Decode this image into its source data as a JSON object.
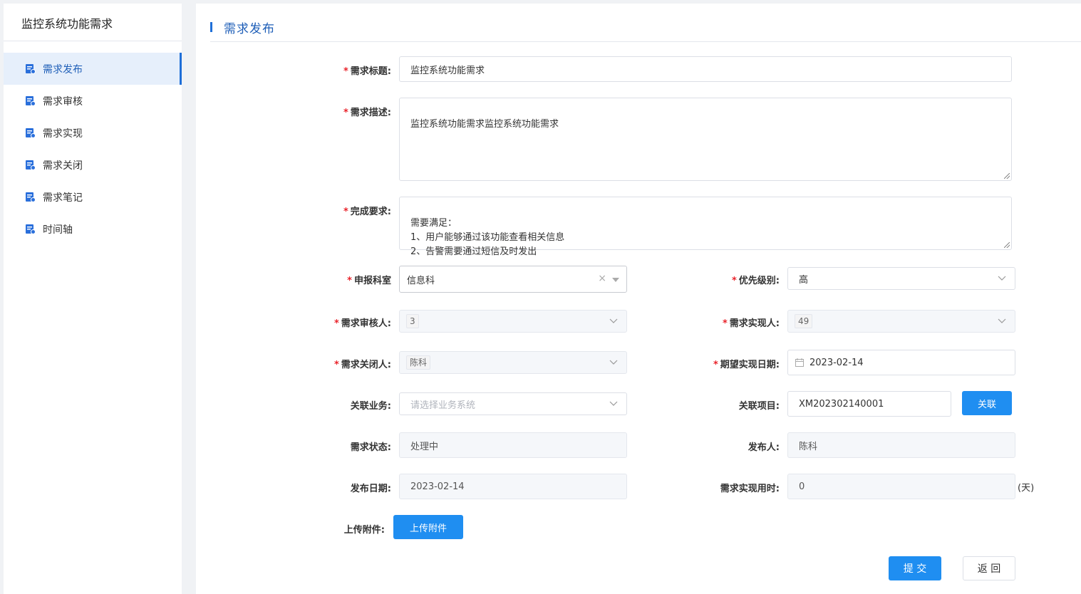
{
  "sidebar": {
    "title": "监控系统功能需求",
    "items": [
      {
        "label": "需求发布"
      },
      {
        "label": "需求审核"
      },
      {
        "label": "需求实现"
      },
      {
        "label": "需求关闭"
      },
      {
        "label": "需求笔记"
      },
      {
        "label": "时间轴"
      }
    ]
  },
  "header": {
    "title": "需求发布"
  },
  "form": {
    "required_mark": "*",
    "title_label": "需求标题:",
    "title_value": "监控系统功能需求",
    "desc_label": "需求描述:",
    "desc_value": "监控系统功能需求监控系统功能需求",
    "completion_label": "完成要求:",
    "completion_value": "需要满足：\n1、用户能够通过该功能查看相关信息\n2、告警需要通过短信及时发出",
    "dept_label": "申报科室",
    "dept_value": "信息科",
    "clear_symbol": "×",
    "priority_label": "优先级别:",
    "priority_value": "高",
    "reviewer_label": "需求审核人:",
    "reviewer_value": "3",
    "implementer_label": "需求实现人:",
    "implementer_value": "49",
    "closer_label": "需求关闭人:",
    "closer_value": "陈科",
    "expected_date_label": "期望实现日期:",
    "expected_date_value": "2023-02-14",
    "business_label": "关联业务:",
    "business_placeholder": "请选择业务系统",
    "project_label": "关联项目:",
    "project_value": "XM202302140001",
    "link_button": "关联",
    "status_label": "需求状态:",
    "status_value": "处理中",
    "publisher_label": "发布人:",
    "publisher_value": "陈科",
    "publish_date_label": "发布日期:",
    "publish_date_value": "2023-02-14",
    "duration_label": "需求实现用时:",
    "duration_value": "0",
    "duration_unit": "(天)",
    "upload_label": "上传附件:",
    "upload_button": "上传附件",
    "submit_button": "提 交",
    "back_button": "返 回"
  }
}
